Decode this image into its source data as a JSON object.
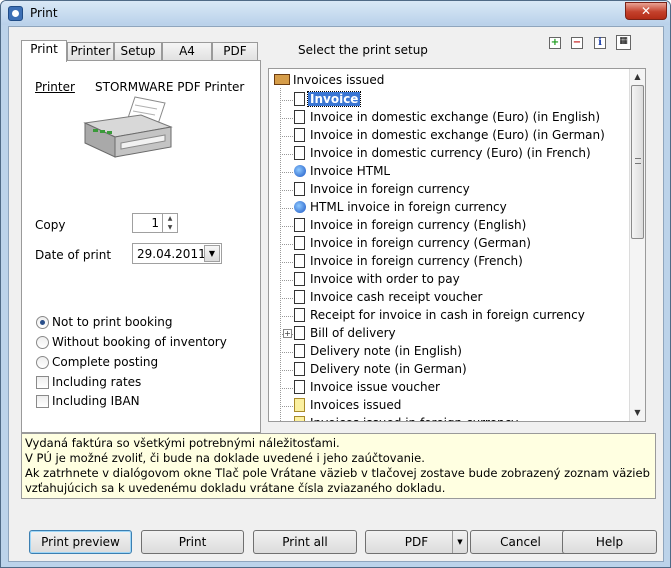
{
  "window": {
    "title": "Print",
    "close_glyph": "✕"
  },
  "tabs": [
    {
      "label": "Print",
      "active": true
    },
    {
      "label": "Printer",
      "active": false
    },
    {
      "label": "Setup",
      "active": false
    },
    {
      "label": "A4",
      "active": false
    },
    {
      "label": "PDF",
      "active": false
    }
  ],
  "print_tab": {
    "printer_label": "Printer",
    "printer_name": "STORMWARE PDF Printer",
    "copy_label": "Copy",
    "copy_value": "1",
    "date_label": "Date of print",
    "date_value": "29.04.2011",
    "radios": [
      {
        "label": "Not to print booking",
        "checked": true
      },
      {
        "label": "Without booking of inventory",
        "checked": false
      },
      {
        "label": "Complete posting",
        "checked": false
      }
    ],
    "checkboxes": [
      {
        "label": "Including rates",
        "checked": false
      },
      {
        "label": "Including IBAN",
        "checked": false
      }
    ]
  },
  "setup_header": {
    "title": "Select the print setup",
    "toolbar_icons": [
      "add-icon",
      "remove-icon",
      "info-icon",
      "calendar-icon"
    ],
    "toolbar_glyphs": {
      "add": "+",
      "remove": "−",
      "info": "i",
      "calendar": "▦"
    }
  },
  "tree": {
    "root_label": "Invoices issued",
    "items": [
      {
        "label": "Invoice",
        "icon": "doc",
        "selected": true
      },
      {
        "label": "Invoice in domestic exchange (Euro) (in English)",
        "icon": "doc"
      },
      {
        "label": "Invoice in domestic exchange (Euro) (in German)",
        "icon": "doc"
      },
      {
        "label": "Invoice in domestic currency (Euro) (in French)",
        "icon": "doc"
      },
      {
        "label": "Invoice HTML",
        "icon": "html"
      },
      {
        "label": "Invoice in foreign currency",
        "icon": "doc"
      },
      {
        "label": "HTML invoice in foreign currency",
        "icon": "html"
      },
      {
        "label": "Invoice in foreign currency (English)",
        "icon": "doc"
      },
      {
        "label": "Invoice in foreign currency (German)",
        "icon": "doc"
      },
      {
        "label": "Invoice in foreign currency (French)",
        "icon": "doc"
      },
      {
        "label": "Invoice with order to pay",
        "icon": "doc"
      },
      {
        "label": "Invoice cash receipt voucher",
        "icon": "doc"
      },
      {
        "label": "Receipt for invoice in cash in foreign currency",
        "icon": "doc"
      },
      {
        "label": "Bill of delivery",
        "icon": "doc",
        "expandable": true
      },
      {
        "label": "Delivery note (in English)",
        "icon": "doc"
      },
      {
        "label": "Delivery note (in German)",
        "icon": "doc"
      },
      {
        "label": "Invoice issue voucher",
        "icon": "doc"
      },
      {
        "label": "Invoices issued",
        "icon": "doc-yellow"
      },
      {
        "label": "Invoices issued in foreign currency",
        "icon": "doc-yellow"
      }
    ]
  },
  "description": [
    "Vydaná faktúra so všetkými potrebnými náležitosťami.",
    "V PÚ je možné zvoliť, či bude na doklade uvedené i jeho zaúčtovanie.",
    "Ak zatrhnete v dialógovom okne Tlač pole Vrátane väzieb v tlačovej zostave bude zobrazený zoznam väzieb",
    "vzťahujúcich sa k uvedenému dokladu vrátane čísla zviazaného dokladu."
  ],
  "buttons": {
    "print_preview": "Print preview",
    "print": "Print",
    "print_all": "Print  all",
    "pdf": "PDF",
    "cancel": "Cancel",
    "help": "Help"
  },
  "glyphs": {
    "spin_up": "▲",
    "spin_down": "▼",
    "dropdown": "▼",
    "scroll_up": "▲",
    "scroll_down": "▼",
    "expand": "+"
  }
}
